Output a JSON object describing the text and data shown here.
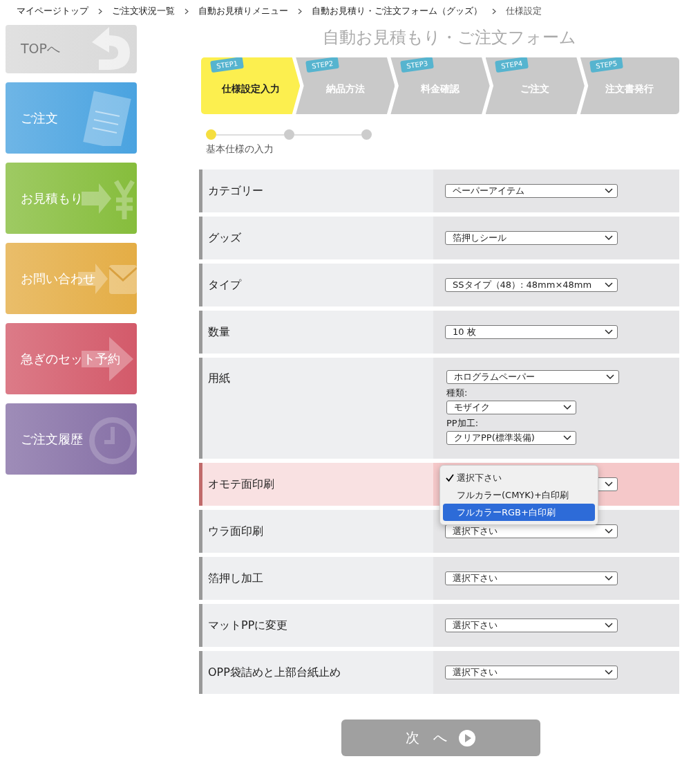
{
  "breadcrumb": [
    "マイページトップ",
    "ご注文状況一覧",
    "自動お見積りメニュー",
    "自動お見積り・ご注文フォーム（グッズ）",
    "仕様設定"
  ],
  "sidebar": {
    "items": [
      {
        "label": "TOPへ",
        "kind": "top",
        "color": "#d9d9d9"
      },
      {
        "label": "ご注文",
        "kind": "order",
        "color": "#4aa3e0"
      },
      {
        "label": "お見積もり",
        "kind": "estimate",
        "color": "#86bd3c"
      },
      {
        "label": "お問い合わせ",
        "kind": "contact",
        "color": "#e4ad45"
      },
      {
        "label": "急ぎのセット予約",
        "kind": "rush",
        "color": "#d35a6a"
      },
      {
        "label": "ご注文履歴",
        "kind": "history",
        "color": "#8670a6"
      }
    ]
  },
  "title": "自動お見積もり・ご注文フォーム",
  "steps": [
    {
      "badge": "STEP1",
      "label": "仕様設定入力",
      "selected": true
    },
    {
      "badge": "STEP2",
      "label": "納品方法",
      "selected": false
    },
    {
      "badge": "STEP3",
      "label": "料金確認",
      "selected": false
    },
    {
      "badge": "STEP4",
      "label": "ご注文",
      "selected": false
    },
    {
      "badge": "STEP5",
      "label": "注文書発行",
      "selected": false
    }
  ],
  "progress": {
    "dots": [
      {
        "selected": true
      },
      {
        "selected": false
      },
      {
        "selected": false
      }
    ],
    "label": "基本仕様の入力"
  },
  "form": {
    "rows": [
      {
        "label": "カテゴリー",
        "kind": "select",
        "highlighted": false,
        "value": "ペーパーアイテム"
      },
      {
        "label": "グッズ",
        "kind": "select",
        "highlighted": false,
        "value": "箔押しシール"
      },
      {
        "label": "タイプ",
        "kind": "select",
        "highlighted": false,
        "value": "SSタイプ（48）: 48mm×48mm"
      },
      {
        "label": "数量",
        "kind": "select",
        "highlighted": false,
        "value": "10 枚"
      },
      {
        "label": "用紙",
        "kind": "paper",
        "highlighted": false,
        "value": "ホログラムペーパー",
        "subfields": [
          {
            "label": "種類:",
            "value": "モザイク"
          },
          {
            "label": "PP加工:",
            "value": "クリアPP(標準装備)"
          }
        ]
      },
      {
        "label": "オモテ面印刷",
        "kind": "select",
        "highlighted": true,
        "dropdown": {
          "options": [
            {
              "label": "選択下さい",
              "checked": true,
              "selected": false
            },
            {
              "label": "フルカラー(CMYK)+白印刷",
              "checked": false,
              "selected": false
            },
            {
              "label": "フルカラーRGB+白印刷",
              "checked": false,
              "selected": true
            }
          ]
        }
      },
      {
        "label": "ウラ面印刷",
        "kind": "select",
        "highlighted": false,
        "value": "選択下さい"
      },
      {
        "label": "箔押し加工",
        "kind": "select",
        "highlighted": false,
        "value": "選択下さい"
      },
      {
        "label": "マットPPに変更",
        "kind": "select",
        "highlighted": false,
        "value": "選択下さい"
      },
      {
        "label": "OPP袋詰めと上部台紙止め",
        "kind": "select",
        "highlighted": false,
        "value": "選択下さい"
      }
    ]
  },
  "next_button": {
    "label": "次　へ"
  }
}
